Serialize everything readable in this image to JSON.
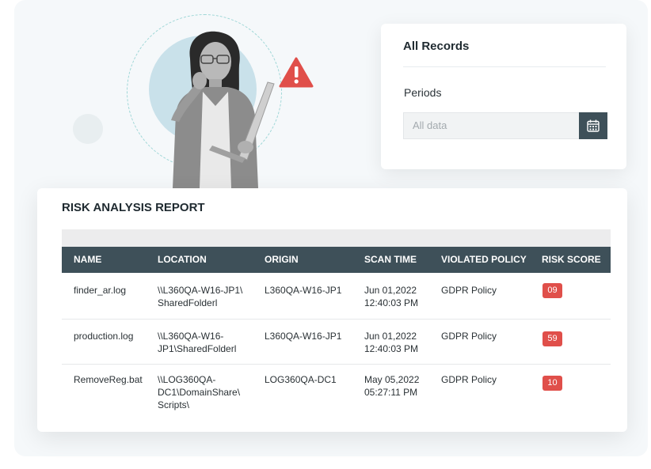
{
  "records": {
    "title": "All Records",
    "periods_label": "Periods",
    "period_value": "All data"
  },
  "report": {
    "title": "RISK ANALYSIS REPORT",
    "columns": [
      "NAME",
      "LOCATION",
      "ORIGIN",
      "SCAN TIME",
      "VIOLATED POLICY",
      "RISK SCORE"
    ],
    "rows": [
      {
        "name": "finder_ar.log",
        "location": [
          "\\\\L360QA-W16-JP1\\",
          "SharedFolderl"
        ],
        "origin": "L360QA-W16-JP1",
        "scan_time": [
          "Jun 01,2022",
          "12:40:03 PM"
        ],
        "policy": "GDPR Policy",
        "risk_score": "09"
      },
      {
        "name": "production.log",
        "location": [
          "\\\\L360QA-W16-",
          "JP1\\SharedFolderl"
        ],
        "origin": "L360QA-W16-JP1",
        "scan_time": [
          "Jun 01,2022",
          "12:40:03 PM"
        ],
        "policy": "GDPR Policy",
        "risk_score": "59"
      },
      {
        "name": "RemoveReg.bat",
        "location": [
          "\\\\LOG360QA-",
          "DC1\\DomainShare\\",
          "Scripts\\"
        ],
        "origin": "LOG360QA-DC1",
        "scan_time": [
          "May 05,2022",
          "05:27:11 PM"
        ],
        "policy": "GDPR Policy",
        "risk_score": "10"
      }
    ]
  },
  "icons": {
    "warning": "warning-triangle-icon",
    "calendar": "calendar-icon"
  },
  "colors": {
    "header_bg": "#3e5059",
    "badge": "#e04f4a",
    "warning": "#e04f4a"
  }
}
